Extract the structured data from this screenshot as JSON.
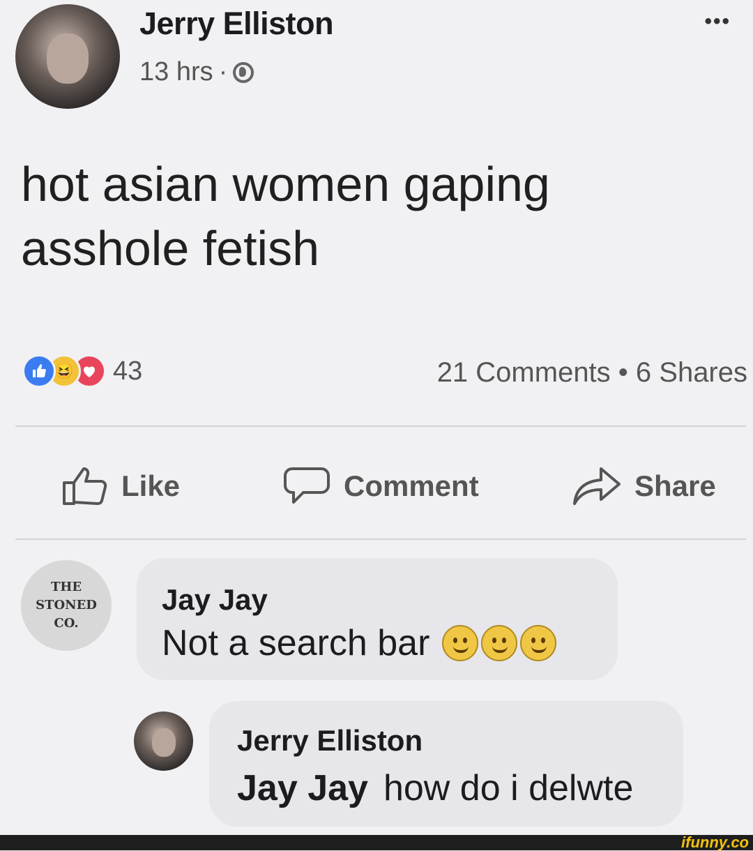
{
  "post": {
    "author": "Jerry Elliston",
    "time": "13 hrs",
    "separator": "·",
    "more": "•••",
    "text": "hot asian women gaping asshole fetish",
    "reaction_count": "43",
    "comments_shares": "21 Comments • 6 Shares"
  },
  "actions": {
    "like": "Like",
    "comment": "Comment",
    "share": "Share"
  },
  "comments": [
    {
      "author": "Jay Jay",
      "text": "Not a search bar",
      "avatar_text": [
        "THE",
        "STONED",
        "CO."
      ]
    },
    {
      "author": "Jerry Elliston",
      "mention": "Jay Jay",
      "text": "how do i delwte"
    }
  ],
  "watermark": "ifunny.co",
  "colors": {
    "like_blue": "#3b7df0",
    "haha_yellow": "#f2c23a",
    "love_red": "#e8455c",
    "background": "#f1f1f3",
    "bubble": "#e6e6eb",
    "watermark": "#f4c20d"
  }
}
